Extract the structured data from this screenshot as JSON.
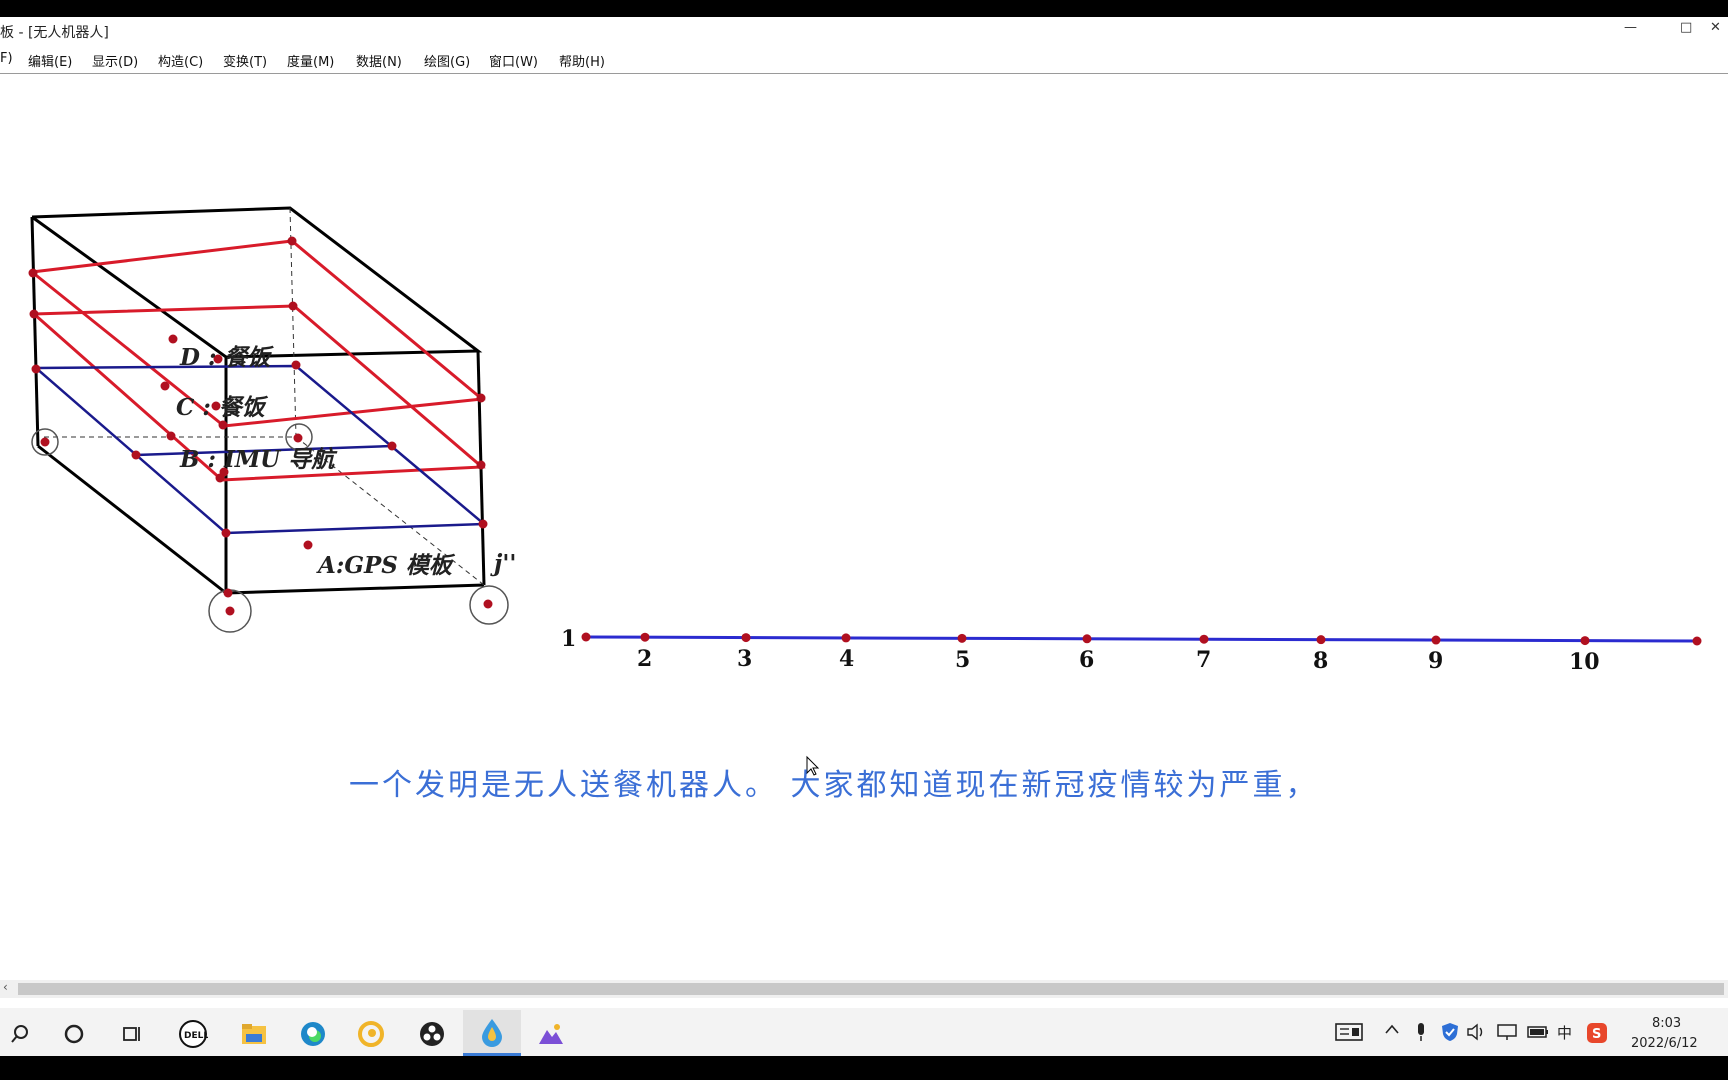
{
  "window": {
    "title": "板 - [无人机器人]",
    "controls": {
      "minimize": "—",
      "maximize": "□",
      "close": "✕"
    }
  },
  "menu": [
    {
      "label": "F)"
    },
    {
      "label": "编辑(E)"
    },
    {
      "label": "显示(D)"
    },
    {
      "label": "构造(C)"
    },
    {
      "label": "变换(T)"
    },
    {
      "label": "度量(M)"
    },
    {
      "label": "数据(N)"
    },
    {
      "label": "绘图(G)"
    },
    {
      "label": "窗口(W)"
    },
    {
      "label": "帮助(H)"
    }
  ],
  "figure": {
    "labels": {
      "d": "D : 餐饭",
      "c": "C : 餐饭",
      "b": "B : IMU 导航",
      "a": "A:GPS 模板",
      "j": "j''"
    },
    "number_line": [
      "1",
      "2",
      "3",
      "4",
      "5",
      "6",
      "7",
      "8",
      "9",
      "10"
    ],
    "colors": {
      "box": "#000000",
      "red_layer": "#d81b2a",
      "blue_layer": "#1a1a8c",
      "point": "#b01020",
      "line": "#2b2bd0"
    }
  },
  "subtitle": "一个发明是无人送餐机器人。 大家都知道现在新冠疫情较为严重，",
  "subtitle_color": "#3b6fd6",
  "taskbar": {
    "icons": [
      "search-icon",
      "cortana-icon",
      "task-view-icon",
      "dell-icon",
      "file-explorer-icon",
      "edge-icon",
      "swirl-app-icon",
      "obs-icon",
      "sketchpad-icon",
      "mountain-app-icon"
    ],
    "tray_icons": [
      "news-icon",
      "chevron-up-icon",
      "mic-icon",
      "shield-icon",
      "volume-icon",
      "network-icon",
      "battery-icon",
      "ime-icon",
      "sogou-icon"
    ],
    "ime_label": "中",
    "time": "8:03",
    "date": "2022/6/12"
  }
}
